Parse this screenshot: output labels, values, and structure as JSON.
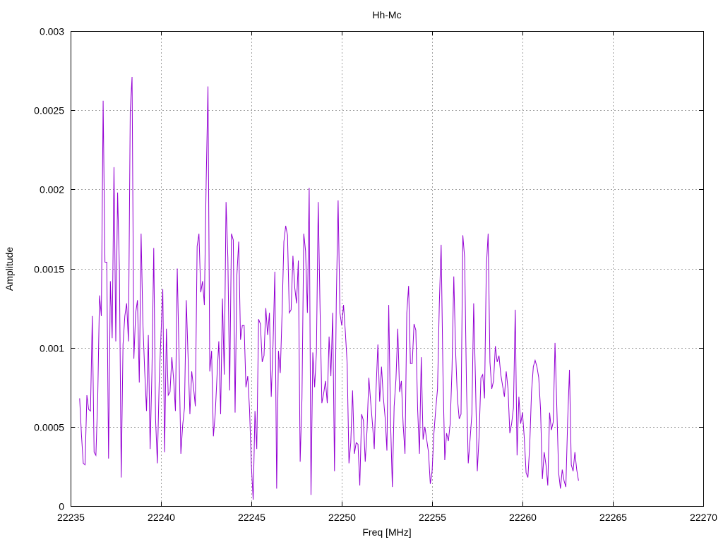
{
  "chart_data": {
    "type": "line",
    "title": "Hh-Mc",
    "xlabel": "Freq [MHz]",
    "ylabel": "Amplitude",
    "xlim": [
      22235,
      22270
    ],
    "ylim": [
      0,
      0.003
    ],
    "x_ticks": [
      22235,
      22240,
      22245,
      22250,
      22255,
      22260,
      22265,
      22270
    ],
    "x_tick_labels": [
      "22235",
      "22240",
      "22245",
      "22250",
      "22255",
      "22260",
      "22265",
      "22270"
    ],
    "y_ticks": [
      0,
      0.0005,
      0.001,
      0.0015,
      0.002,
      0.0025,
      0.003
    ],
    "y_tick_labels": [
      "0",
      "0.0005",
      "0.001",
      "0.0015",
      "0.002",
      "0.0025",
      "0.003"
    ],
    "grid": true,
    "line_color": "#9400d3",
    "x_start": 22235.5,
    "x_step": 0.1,
    "series": [
      {
        "values": [
          0.00068,
          0.00045,
          0.00027,
          0.00026,
          0.0007,
          0.00061,
          0.0006,
          0.0012,
          0.00034,
          0.00032,
          0.00068,
          0.00133,
          0.0012,
          0.00256,
          0.00154,
          0.00154,
          0.0003,
          0.00142,
          0.00106,
          0.00214,
          0.00104,
          0.00198,
          0.0015,
          0.00018,
          0.00102,
          0.0012,
          0.00128,
          0.00104,
          0.0025,
          0.00271,
          0.00093,
          0.00122,
          0.0013,
          0.00078,
          0.00172,
          0.00115,
          0.00085,
          0.0006,
          0.00108,
          0.00036,
          0.00085,
          0.00163,
          0.00055,
          0.00027,
          0.00078,
          0.00108,
          0.00137,
          0.00034,
          0.00112,
          0.0007,
          0.00072,
          0.00094,
          0.0008,
          0.0006,
          0.0015,
          0.00095,
          0.00033,
          0.00051,
          0.00062,
          0.0013,
          0.00094,
          0.00058,
          0.00085,
          0.00075,
          0.00063,
          0.00164,
          0.00172,
          0.00135,
          0.00142,
          0.00127,
          0.00205,
          0.00265,
          0.00085,
          0.00098,
          0.00044,
          0.00058,
          0.00082,
          0.00104,
          0.00058,
          0.00131,
          0.00083,
          0.00192,
          0.00157,
          0.00073,
          0.00172,
          0.00168,
          0.00059,
          0.00146,
          0.00167,
          0.00105,
          0.00114,
          0.00114,
          0.00075,
          0.00082,
          0.00061,
          0.00026,
          4e-05,
          0.0006,
          0.00036,
          0.00118,
          0.00115,
          0.00091,
          0.00095,
          0.00125,
          0.00108,
          0.00122,
          0.00069,
          0.00102,
          0.00148,
          0.00011,
          0.00098,
          0.00084,
          0.00122,
          0.00167,
          0.00177,
          0.00171,
          0.00122,
          0.00124,
          0.00158,
          0.00138,
          0.00128,
          0.00155,
          0.00028,
          0.00068,
          0.00172,
          0.00161,
          0.00122,
          0.00201,
          7e-05,
          0.00097,
          0.00075,
          0.00097,
          0.00192,
          0.00125,
          0.00065,
          0.00071,
          0.00079,
          0.00065,
          0.00107,
          0.00082,
          0.00122,
          0.00022,
          0.0013,
          0.00193,
          0.00122,
          0.00114,
          0.00127,
          0.0011,
          0.0009,
          0.00027,
          0.0004,
          0.00073,
          0.00033,
          0.0004,
          0.00039,
          0.00013,
          0.00058,
          0.00054,
          0.00028,
          0.00048,
          0.00081,
          0.00066,
          0.00052,
          0.00036,
          0.00074,
          0.00102,
          0.00066,
          0.00088,
          0.00069,
          0.00056,
          0.00035,
          0.00127,
          0.00054,
          0.00012,
          0.00063,
          0.0008,
          0.00112,
          0.00072,
          0.00079,
          0.00051,
          0.00033,
          0.00122,
          0.00139,
          0.0009,
          0.0009,
          0.00115,
          0.00111,
          0.00061,
          0.00033,
          0.00094,
          0.00042,
          0.0005,
          0.00042,
          0.00034,
          0.00014,
          0.00022,
          0.00046,
          0.00061,
          0.00074,
          0.00128,
          0.00165,
          0.00084,
          0.00029,
          0.00046,
          0.00041,
          0.00052,
          0.00086,
          0.00145,
          0.00098,
          0.00068,
          0.00055,
          0.00058,
          0.00171,
          0.00157,
          0.00077,
          0.00027,
          0.00042,
          0.00058,
          0.00128,
          0.00079,
          0.00022,
          0.00044,
          0.00081,
          0.00083,
          0.00068,
          0.00151,
          0.00172,
          0.00091,
          0.00074,
          0.00079,
          0.00101,
          0.00091,
          0.00095,
          0.00083,
          0.00076,
          0.00069,
          0.00085,
          0.00074,
          0.00046,
          0.00052,
          0.00062,
          0.00124,
          0.00032,
          0.00069,
          0.00052,
          0.00059,
          0.00043,
          0.00021,
          0.00018,
          0.00038,
          0.00072,
          0.00088,
          0.00092,
          0.00088,
          0.00081,
          0.00061,
          0.00017,
          0.00034,
          0.00026,
          0.00013,
          0.00059,
          0.00048,
          0.00053,
          0.00103,
          0.00062,
          0.00021,
          0.00011,
          0.00023,
          0.00016,
          0.00012,
          0.00054,
          0.00086,
          0.00026,
          0.00022,
          0.00034,
          0.00023,
          0.00016
        ]
      }
    ]
  }
}
